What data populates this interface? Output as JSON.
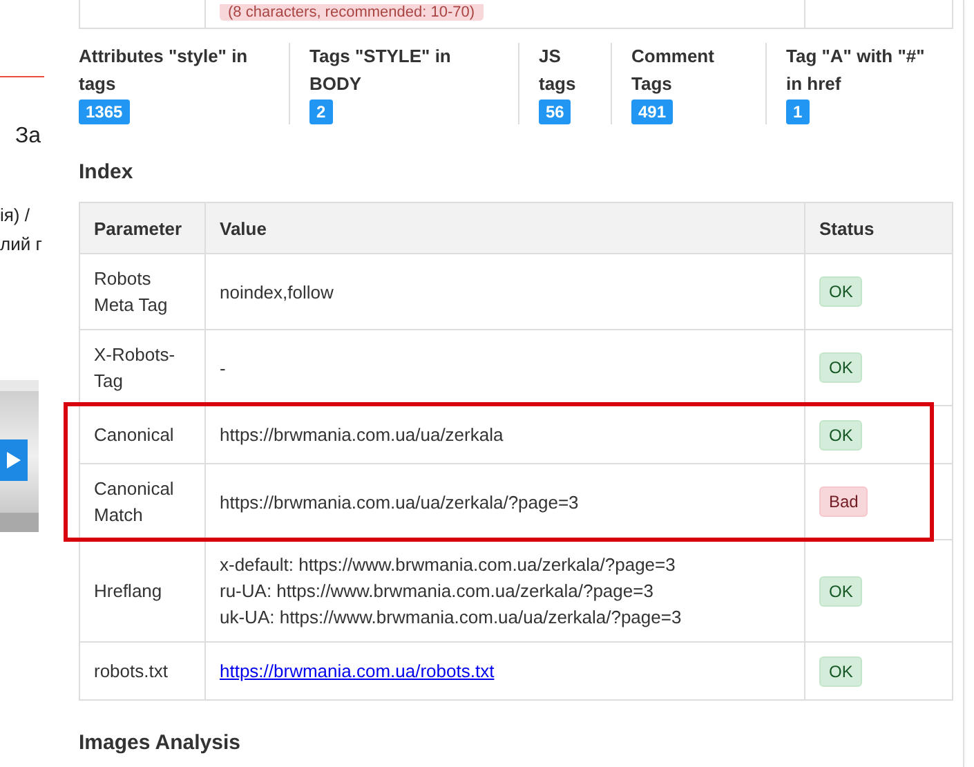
{
  "background_page": {
    "texts": [
      "За",
      "ія) /",
      "лий г"
    ]
  },
  "panel": {
    "top_row": {
      "note": "(8 characters, recommended: 10-70)"
    },
    "stats": [
      {
        "label": "Attributes \"style\" in tags",
        "count": "1365"
      },
      {
        "label": "Tags \"STYLE\" in BODY",
        "count": "2"
      },
      {
        "label": "JS tags",
        "count": "56"
      },
      {
        "label": "Comment Tags",
        "count": "491"
      },
      {
        "label": "Tag \"A\" with \"#\" in href",
        "count": "1"
      }
    ],
    "index": {
      "title": "Index",
      "columns": [
        "Parameter",
        "Value",
        "Status"
      ],
      "rows": [
        {
          "parameter": "Robots Meta Tag",
          "kind": "text",
          "values": [
            "noindex,follow"
          ],
          "status": {
            "text": "OK",
            "kind": "ok"
          },
          "highlighted": false
        },
        {
          "parameter": "X-Robots-Tag",
          "kind": "text",
          "values": [
            "-"
          ],
          "status": {
            "text": "OK",
            "kind": "ok"
          },
          "highlighted": false
        },
        {
          "parameter": "Canonical",
          "kind": "text",
          "values": [
            "https://brwmania.com.ua/ua/zerkala"
          ],
          "status": {
            "text": "OK",
            "kind": "ok"
          },
          "highlighted": true
        },
        {
          "parameter": "Canonical Match",
          "kind": "text",
          "values": [
            "https://brwmania.com.ua/ua/zerkala/?page=3"
          ],
          "status": {
            "text": "Bad",
            "kind": "bad"
          },
          "highlighted": true
        },
        {
          "parameter": "Hreflang",
          "kind": "text",
          "values": [
            "x-default: https://www.brwmania.com.ua/zerkala/?page=3",
            "ru-UA: https://www.brwmania.com.ua/zerkala/?page=3",
            "uk-UA: https://www.brwmania.com.ua/ua/zerkala/?page=3"
          ],
          "status": {
            "text": "OK",
            "kind": "ok"
          },
          "highlighted": false
        },
        {
          "parameter": "robots.txt",
          "kind": "link",
          "values": [
            "https://brwmania.com.ua/robots.txt"
          ],
          "status": {
            "text": "OK",
            "kind": "ok"
          },
          "highlighted": false
        }
      ]
    },
    "images_title": "Images Analysis"
  }
}
